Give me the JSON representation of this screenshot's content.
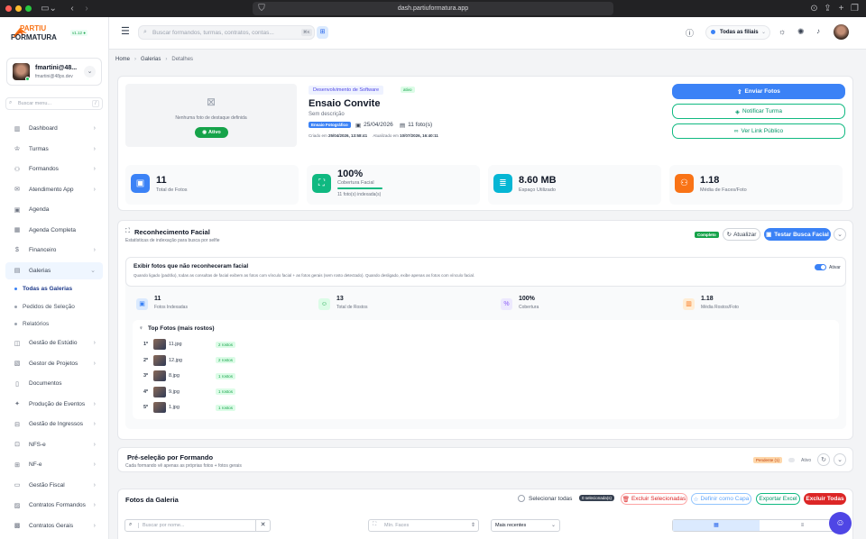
{
  "browser": {
    "url": "dash.partiuformatura.app"
  },
  "brand": {
    "line1": "PARTIU",
    "line2": "FORMATURA",
    "version": "v1.12 ●"
  },
  "user": {
    "name": "fmartini@48...",
    "email": "fmartini@48px.dev"
  },
  "sidebar": {
    "search_placeholder": "Buscar menu...",
    "search_shortcut": "/",
    "items": [
      {
        "label": "Dashboard",
        "icon": "chart-icon",
        "chev": "›"
      },
      {
        "label": "Turmas",
        "icon": "graduation-cap-icon",
        "chev": "›"
      },
      {
        "label": "Formandos",
        "icon": "users-icon",
        "chev": "›"
      },
      {
        "label": "Atendimento App",
        "icon": "chat-icon",
        "chev": "›"
      },
      {
        "label": "Agenda",
        "icon": "calendar-icon",
        "chev": ""
      },
      {
        "label": "Agenda Completa",
        "icon": "calendar-full-icon",
        "chev": ""
      },
      {
        "label": "Financeiro",
        "icon": "dollar-icon",
        "chev": "›"
      },
      {
        "label": "Galerias",
        "icon": "image-icon",
        "chev": "⌄"
      }
    ],
    "sub_items": [
      "Todas as Galerias",
      "Pedidos de Seleção",
      "Relatórios"
    ],
    "items2": [
      {
        "label": "Gestão de Estúdio",
        "icon": "studio-icon",
        "chev": "›"
      },
      {
        "label": "Gestor de Projetos",
        "icon": "projects-icon",
        "chev": "›"
      },
      {
        "label": "Documentos",
        "icon": "document-icon",
        "chev": ""
      },
      {
        "label": "Produção de Eventos",
        "icon": "event-icon",
        "chev": "›"
      },
      {
        "label": "Gestão de Ingressos",
        "icon": "ticket-icon",
        "chev": "›"
      },
      {
        "label": "NFS-e",
        "icon": "invoice-icon",
        "chev": "›"
      },
      {
        "label": "NF-e",
        "icon": "invoice2-icon",
        "chev": "›"
      },
      {
        "label": "Gestão Fiscal",
        "icon": "fiscal-icon",
        "chev": "›"
      },
      {
        "label": "Contratos Formandos",
        "icon": "contract-icon",
        "chev": "›"
      },
      {
        "label": "Contratos Gerais",
        "icon": "contract2-icon",
        "chev": "›"
      }
    ]
  },
  "topbar": {
    "search_placeholder": "Buscar formandos, turmas, contratos, contas...",
    "shortcut": "⌘K",
    "filial": "Todas as filiais"
  },
  "breadcrumb": [
    "Home",
    "Galerias",
    "Detalhes"
  ],
  "gallery": {
    "no_photo": "Nenhuma foto de destaque definida",
    "status": "Ativo",
    "dept": "Desenvolvimento de Software",
    "dept_badge": "ativo",
    "title": "Ensaio Convite",
    "description": "Sem descrição",
    "type_badge": "Ensaio Fotográfico",
    "date": "25/04/2026",
    "photos_count": "11 foto(s)",
    "created_label": "Criado em",
    "created": "25/04/2026, 13:58:41",
    "updated_label": "Atualizado em",
    "updated": "10/07/2026, 16:40:11",
    "btn_send": "Enviar Fotos",
    "btn_notify": "Notificar Turma",
    "btn_link": "Ver Link Público"
  },
  "stats": [
    {
      "value": "11",
      "label": "Total de Fotos",
      "color": "#3b82f6"
    },
    {
      "value": "100%",
      "label": "Cobertura Facial",
      "sub": "11 foto(s) indexada(s)",
      "color": "#10b981",
      "progress": 1
    },
    {
      "value": "8.60 MB",
      "label": "Espaço Utilizado",
      "color": "#06b6d4"
    },
    {
      "value": "1.18",
      "label": "Média de Faces/Foto",
      "color": "#f97316"
    }
  ],
  "facial": {
    "title": "Reconhecimento Facial",
    "subtitle": "Estatísticas de indexação para busca por selfie",
    "badge": "Completo",
    "btn_refresh": "Atualizar",
    "btn_test": "Testar Busca Facial",
    "toggle_title": "Exibir fotos que não reconheceram facial",
    "toggle_desc": "Quando ligado (padrão), todas as consultas de facial exibem as fotos com vínculo facial + as fotos gerais (sem rosto detectado). Quando desligado, exibe apenas as fotos com vínculo facial.",
    "toggle_label": "Ativar",
    "stats": [
      {
        "value": "11",
        "label": "Fotos Indexadas"
      },
      {
        "value": "13",
        "label": "Total de Rostos"
      },
      {
        "value": "100%",
        "label": "Cobertura"
      },
      {
        "value": "1.18",
        "label": "Média Rostos/Foto"
      }
    ],
    "top_title": "Top Fotos (mais rostos)",
    "top": [
      {
        "rank": "1º",
        "file": "11.jpg",
        "faces": "2 rostos"
      },
      {
        "rank": "2º",
        "file": "12.jpg",
        "faces": "2 rostos"
      },
      {
        "rank": "3º",
        "file": "8.jpg",
        "faces": "1 rostos"
      },
      {
        "rank": "4º",
        "file": "9.jpg",
        "faces": "1 rostos"
      },
      {
        "rank": "5º",
        "file": "1.jpg",
        "faces": "1 rostos"
      }
    ]
  },
  "preselection": {
    "title": "Pré-seleção por Formando",
    "subtitle": "Cada formando vê apenas as próprias fotos + fotos gerais",
    "badge": "Pendente (1)",
    "toggle_label": "Ativo"
  },
  "photos": {
    "title": "Fotos da Galeria",
    "select_all": "Selecionar todas",
    "selected": "0 selecionada(s)",
    "btn_delete_sel": "Excluir Selecionadas",
    "btn_cover": "Definir como Capa",
    "btn_export": "Exportar Excel",
    "btn_delete_all": "Excluir Todas",
    "search_placeholder": "Buscar por nome...",
    "faces_placeholder": "Mín. Faces",
    "sort": "Mais recentes"
  }
}
